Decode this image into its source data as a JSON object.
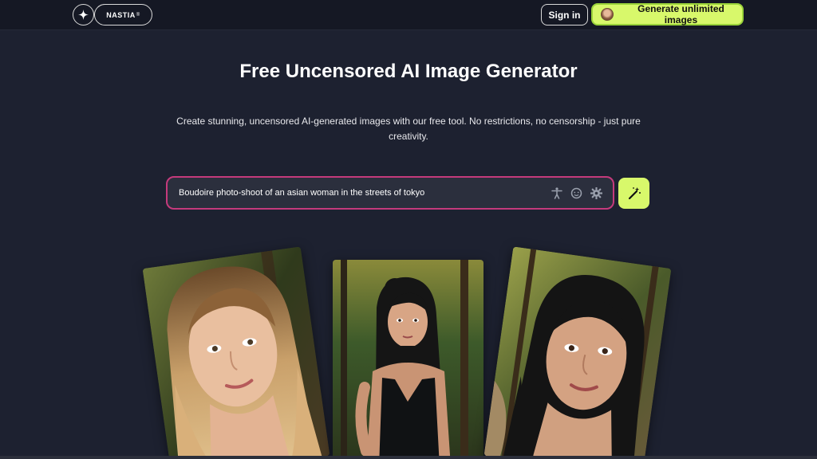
{
  "nav": {
    "logo_icon": "sparkle-icon",
    "brand": "NASTIA",
    "brand_mark": "®",
    "signin_label": "Sign in",
    "generate_label": "Generate unlimited images"
  },
  "hero": {
    "title": "Free Uncensored AI Image Generator",
    "subtitle": "Create stunning, uncensored AI-generated images with our free tool. No restrictions, no censorship - just pure creativity."
  },
  "prompt": {
    "value": "Boudoire photo-shoot of an asian woman in the streets of tokyo",
    "icons": [
      "pose-icon",
      "face-icon",
      "settings-gear-icon"
    ],
    "submit_icon": "magic-wand-icon"
  },
  "gallery": {
    "cards": [
      {
        "subject": "blonde woman portrait in forest"
      },
      {
        "subject": "woman with dark hair in black dress on forest path"
      },
      {
        "subject": "dark-haired woman portrait in forest"
      }
    ]
  },
  "colors": {
    "background": "#1d2130",
    "accent_lime": "#d8f86b",
    "prompt_border": "#c53a7c"
  }
}
